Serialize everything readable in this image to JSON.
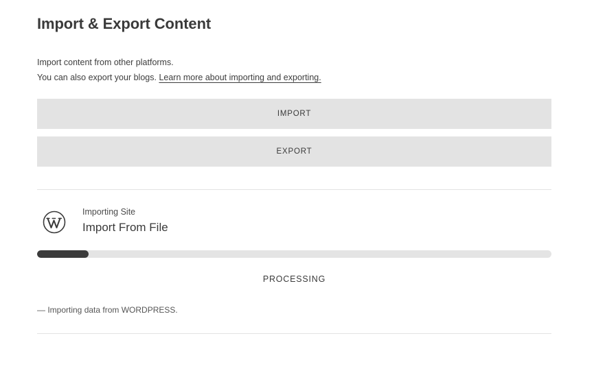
{
  "page": {
    "title": "Import & Export Content",
    "intro_line1": "Import content from other platforms.",
    "intro_line2": "You can also export your blogs. ",
    "learn_more_link": "Learn more about importing and exporting."
  },
  "actions": {
    "import_label": "IMPORT",
    "export_label": "EXPORT"
  },
  "job": {
    "icon": "wordpress-icon",
    "kicker": "Importing Site",
    "title": "Import From File",
    "progress": 0.1,
    "status": "PROCESSING",
    "log": "— Importing data from WORDPRESS."
  },
  "colors": {
    "button_bg": "#e3e3e3",
    "progress_track": "#e4e4e4",
    "progress_fill": "#3b3b3b",
    "text": "#3a3a3a"
  }
}
